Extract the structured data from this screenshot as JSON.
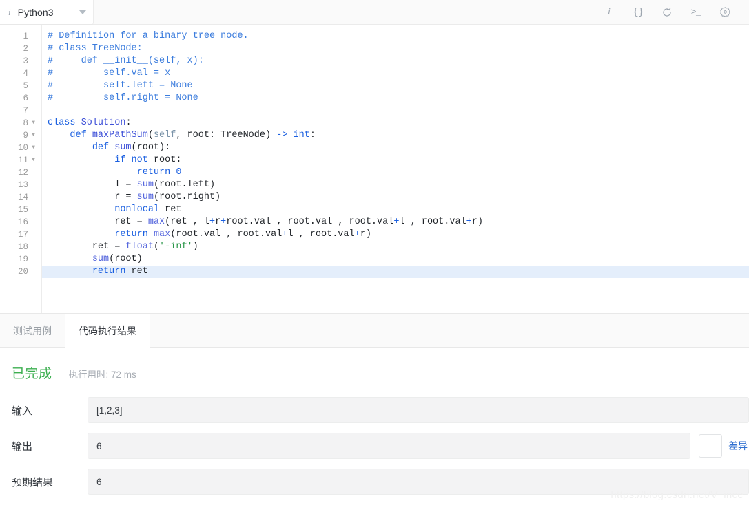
{
  "topbar": {
    "language": "Python3",
    "info_glyph": "i",
    "tools": [
      {
        "name": "info-icon",
        "label": "i"
      },
      {
        "name": "format-braces-icon",
        "label": "{}"
      },
      {
        "name": "reset-code-icon",
        "label": "↺"
      },
      {
        "name": "console-icon",
        "label": ">_"
      },
      {
        "name": "settings-gear-icon",
        "label": "⚙"
      }
    ]
  },
  "editor": {
    "active_line": 20,
    "lines": [
      {
        "n": 1,
        "fold": false,
        "tokens": [
          {
            "t": "com",
            "s": "# Definition for a binary tree node."
          }
        ]
      },
      {
        "n": 2,
        "fold": false,
        "tokens": [
          {
            "t": "com",
            "s": "# class TreeNode:"
          }
        ]
      },
      {
        "n": 3,
        "fold": false,
        "tokens": [
          {
            "t": "com",
            "s": "#     def __init__(self, x):"
          }
        ]
      },
      {
        "n": 4,
        "fold": false,
        "tokens": [
          {
            "t": "com",
            "s": "#         self.val = x"
          }
        ]
      },
      {
        "n": 5,
        "fold": false,
        "tokens": [
          {
            "t": "com",
            "s": "#         self.left = None"
          }
        ]
      },
      {
        "n": 6,
        "fold": false,
        "tokens": [
          {
            "t": "com",
            "s": "#         self.right = None"
          }
        ]
      },
      {
        "n": 7,
        "fold": false,
        "tokens": [
          {
            "t": "pl",
            "s": ""
          }
        ]
      },
      {
        "n": 8,
        "fold": true,
        "tokens": [
          {
            "t": "kw",
            "s": "class"
          },
          {
            "t": "pl",
            "s": " "
          },
          {
            "t": "fn",
            "s": "Solution"
          },
          {
            "t": "pl",
            "s": ":"
          }
        ]
      },
      {
        "n": 9,
        "fold": true,
        "tokens": [
          {
            "t": "pl",
            "s": "    "
          },
          {
            "t": "kw",
            "s": "def"
          },
          {
            "t": "pl",
            "s": " "
          },
          {
            "t": "fn",
            "s": "maxPathSum"
          },
          {
            "t": "pl",
            "s": "("
          },
          {
            "t": "self",
            "s": "self"
          },
          {
            "t": "pl",
            "s": ", root: TreeNode) "
          },
          {
            "t": "op",
            "s": "->"
          },
          {
            "t": "pl",
            "s": " "
          },
          {
            "t": "kw",
            "s": "int"
          },
          {
            "t": "pl",
            "s": ":"
          }
        ]
      },
      {
        "n": 10,
        "fold": true,
        "tokens": [
          {
            "t": "pl",
            "s": "        "
          },
          {
            "t": "kw",
            "s": "def"
          },
          {
            "t": "pl",
            "s": " "
          },
          {
            "t": "fn",
            "s": "sum"
          },
          {
            "t": "pl",
            "s": "(root):"
          }
        ]
      },
      {
        "n": 11,
        "fold": true,
        "tokens": [
          {
            "t": "pl",
            "s": "            "
          },
          {
            "t": "kw",
            "s": "if"
          },
          {
            "t": "pl",
            "s": " "
          },
          {
            "t": "kw",
            "s": "not"
          },
          {
            "t": "pl",
            "s": " root:"
          }
        ]
      },
      {
        "n": 12,
        "fold": false,
        "tokens": [
          {
            "t": "pl",
            "s": "                "
          },
          {
            "t": "kw",
            "s": "return"
          },
          {
            "t": "pl",
            "s": " "
          },
          {
            "t": "num",
            "s": "0"
          }
        ]
      },
      {
        "n": 13,
        "fold": false,
        "tokens": [
          {
            "t": "pl",
            "s": "            l = "
          },
          {
            "t": "bi",
            "s": "sum"
          },
          {
            "t": "pl",
            "s": "(root.left)"
          }
        ]
      },
      {
        "n": 14,
        "fold": false,
        "tokens": [
          {
            "t": "pl",
            "s": "            r = "
          },
          {
            "t": "bi",
            "s": "sum"
          },
          {
            "t": "pl",
            "s": "(root.right)"
          }
        ]
      },
      {
        "n": 15,
        "fold": false,
        "tokens": [
          {
            "t": "pl",
            "s": "            "
          },
          {
            "t": "kw",
            "s": "nonlocal"
          },
          {
            "t": "pl",
            "s": " ret"
          }
        ]
      },
      {
        "n": 16,
        "fold": false,
        "tokens": [
          {
            "t": "pl",
            "s": "            ret = "
          },
          {
            "t": "bi",
            "s": "max"
          },
          {
            "t": "pl",
            "s": "(ret , l"
          },
          {
            "t": "op",
            "s": "+"
          },
          {
            "t": "pl",
            "s": "r"
          },
          {
            "t": "op",
            "s": "+"
          },
          {
            "t": "pl",
            "s": "root.val , root.val , root.val"
          },
          {
            "t": "op",
            "s": "+"
          },
          {
            "t": "pl",
            "s": "l , root.val"
          },
          {
            "t": "op",
            "s": "+"
          },
          {
            "t": "pl",
            "s": "r)"
          }
        ]
      },
      {
        "n": 17,
        "fold": false,
        "tokens": [
          {
            "t": "pl",
            "s": "            "
          },
          {
            "t": "kw",
            "s": "return"
          },
          {
            "t": "pl",
            "s": " "
          },
          {
            "t": "bi",
            "s": "max"
          },
          {
            "t": "pl",
            "s": "(root.val , root.val"
          },
          {
            "t": "op",
            "s": "+"
          },
          {
            "t": "pl",
            "s": "l , root.val"
          },
          {
            "t": "op",
            "s": "+"
          },
          {
            "t": "pl",
            "s": "r)"
          }
        ]
      },
      {
        "n": 18,
        "fold": false,
        "tokens": [
          {
            "t": "pl",
            "s": "        ret = "
          },
          {
            "t": "bi",
            "s": "float"
          },
          {
            "t": "pl",
            "s": "("
          },
          {
            "t": "str",
            "s": "'-inf'"
          },
          {
            "t": "pl",
            "s": ")"
          }
        ]
      },
      {
        "n": 19,
        "fold": false,
        "tokens": [
          {
            "t": "pl",
            "s": "        "
          },
          {
            "t": "bi",
            "s": "sum"
          },
          {
            "t": "pl",
            "s": "(root)"
          }
        ]
      },
      {
        "n": 20,
        "fold": false,
        "tokens": [
          {
            "t": "pl",
            "s": "        "
          },
          {
            "t": "kw",
            "s": "return"
          },
          {
            "t": "pl",
            "s": " ret"
          }
        ]
      }
    ]
  },
  "tabs": [
    {
      "label": "测试用例",
      "active": false,
      "name": "tab-testcase"
    },
    {
      "label": "代码执行结果",
      "active": true,
      "name": "tab-run-result"
    }
  ],
  "result": {
    "status": "已完成",
    "status_color": "#3caf50",
    "runtime": "执行用时: 72 ms",
    "rows": [
      {
        "label": "输入",
        "value": "[1,2,3]",
        "name": "input"
      },
      {
        "label": "输出",
        "value": "6",
        "name": "output"
      },
      {
        "label": "预期结果",
        "value": "6",
        "name": "expected"
      }
    ],
    "diff_label": "差异"
  },
  "watermark": "https://blog.csdn.net/V_ince"
}
